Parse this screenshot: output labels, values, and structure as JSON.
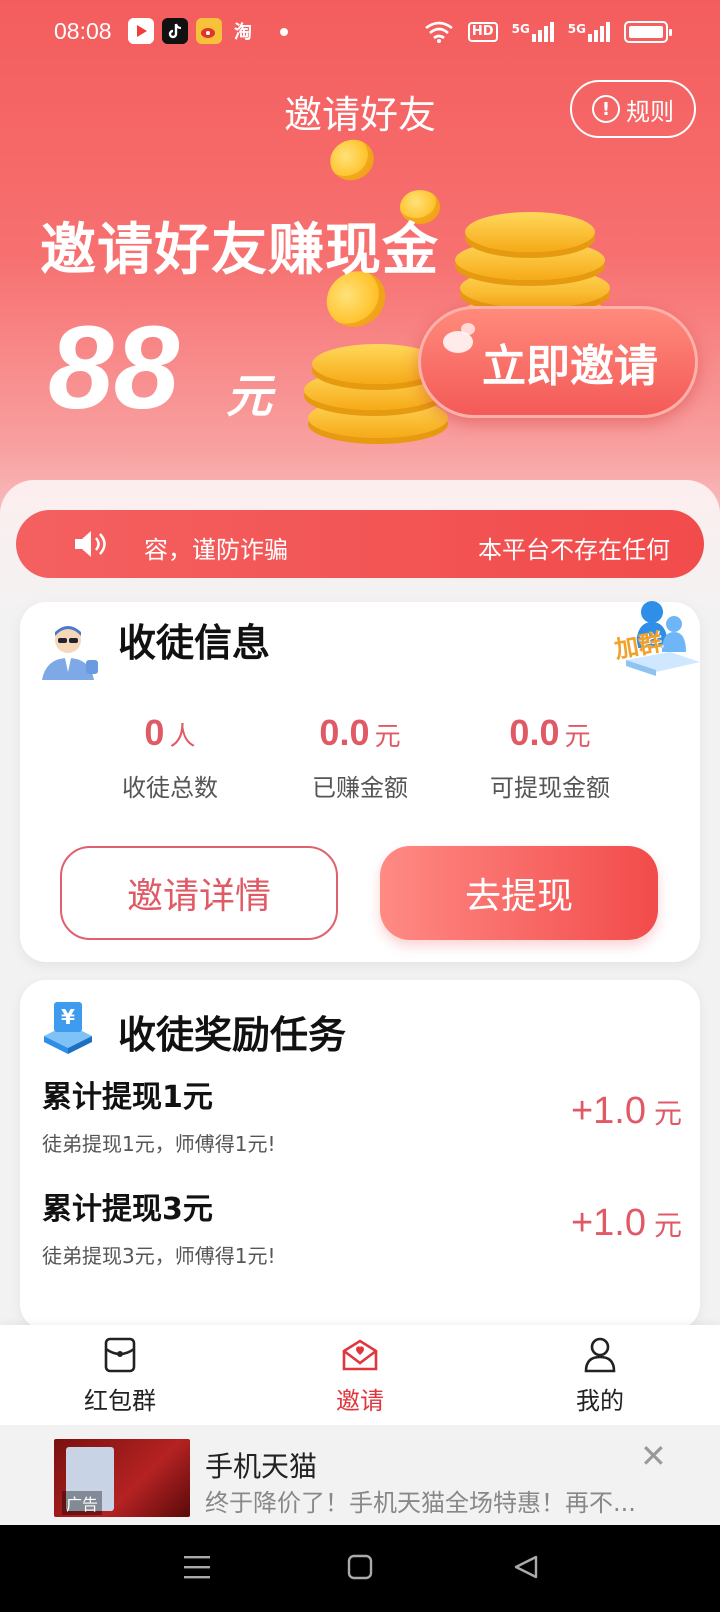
{
  "status_bar": {
    "time": "08:08",
    "network_labels": [
      "HD",
      "5G",
      "5G"
    ]
  },
  "header": {
    "title": "邀请好友",
    "rules_label": "规则"
  },
  "hero": {
    "headline": "邀请好友赚现金",
    "amount": "88",
    "amount_unit": "元",
    "invite_button": "立即邀请"
  },
  "marquee": {
    "text_left": "容，谨防诈骗",
    "text_right": "本平台不存在任何"
  },
  "apprentice_info": {
    "title": "收徒信息",
    "join_group_label": "加群",
    "stats": [
      {
        "value": "0",
        "unit": "人",
        "label": "收徒总数"
      },
      {
        "value": "0.0",
        "unit": "元",
        "label": "已赚金额"
      },
      {
        "value": "0.0",
        "unit": "元",
        "label": "可提现金额"
      }
    ],
    "details_button": "邀请详情",
    "withdraw_button": "去提现"
  },
  "reward_tasks": {
    "title": "收徒奖励任务",
    "items": [
      {
        "title": "累计提现1元",
        "desc": "徒弟提现1元，师傅得1元!",
        "reward": "+1.0",
        "unit": "元"
      },
      {
        "title": "累计提现3元",
        "desc": "徒弟提现3元，师傅得1元!",
        "reward": "+1.0",
        "unit": "元"
      }
    ]
  },
  "tabbar": {
    "items": [
      {
        "label": "红包群",
        "icon": "red-packet-icon",
        "active": false
      },
      {
        "label": "邀请",
        "icon": "invite-envelope-icon",
        "active": true
      },
      {
        "label": "我的",
        "icon": "user-icon",
        "active": false
      }
    ]
  },
  "ad": {
    "title": "手机天猫",
    "desc": "终于降价了！手机天猫全场特惠！再不...",
    "thumb_label": "广告"
  },
  "colors": {
    "accent": "#f24b4b",
    "accent_text": "#e05a66",
    "tab_active": "#e0363c"
  }
}
